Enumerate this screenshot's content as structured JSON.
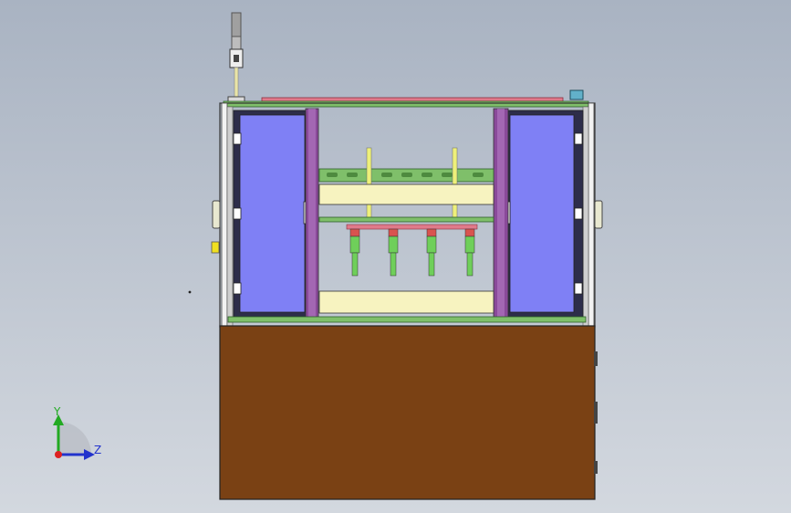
{
  "scene": {
    "type": "cad-front-view",
    "colors": {
      "background_top": "#a9b3c2",
      "background_bottom": "#d3d8df",
      "cabinet_base": "#7a4114",
      "door_panel": "#7f80f5",
      "frame_purple": "#8a4a9a",
      "rail_green": "#7fbf6a",
      "plate_cream": "#f7f3c0",
      "top_bar_pink": "#e07a8a",
      "actuator_green": "#6fcf5a",
      "actuator_red": "#d9534f",
      "signal_light": "#9a9a9a"
    },
    "actuator_count": 4
  },
  "triad": {
    "y_label": "Y",
    "z_label": "Z",
    "icon": "axis-triad-icon"
  }
}
